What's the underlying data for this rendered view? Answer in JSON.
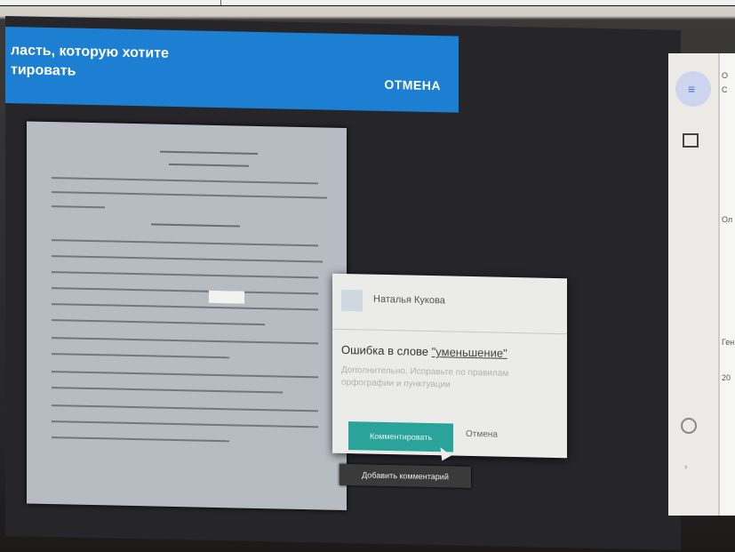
{
  "banner": {
    "message_line1": "ласть, которую хотите",
    "message_line2": "тировать",
    "cancel_label": "ОТМЕНА"
  },
  "comment_popup": {
    "author": "Наталья Кукова",
    "error_prefix": "Ошибка в слове ",
    "error_word": "\"уменьшение\"",
    "description": "Дополнительно. Исправьте по правилам орфографии и пунктуации",
    "primary_button_label": "Комментировать",
    "secondary_button_label": "Отмена",
    "tooltip": "Добавить комментарий"
  },
  "right_panel": {
    "labels": [
      "О",
      "С",
      "Ол",
      "Ген",
      "20"
    ]
  },
  "icons": {
    "doc_icon": "document-icon",
    "side_icon": "panel-icon"
  },
  "colors": {
    "banner": "#1d7fd2",
    "primary_button": "#2aa39a"
  }
}
